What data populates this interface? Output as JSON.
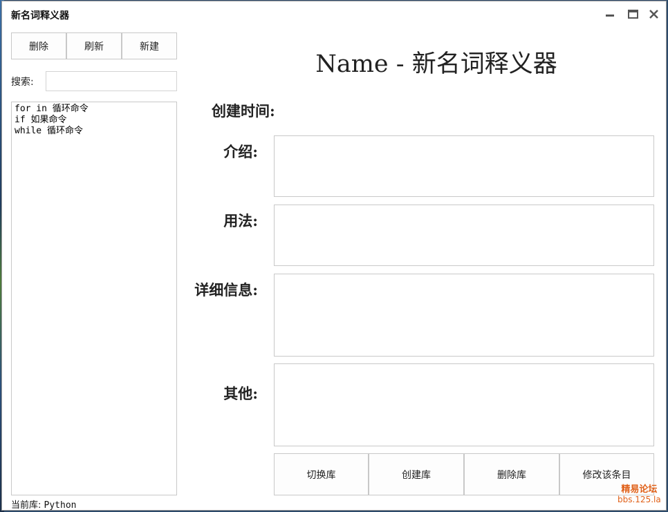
{
  "window": {
    "title": "新名词释义器",
    "controls": {
      "minimize": "minimize-icon",
      "maximize": "maximize-icon",
      "close": "close-icon"
    }
  },
  "toolbar": {
    "delete_label": "删除",
    "refresh_label": "刷新",
    "new_label": "新建"
  },
  "search": {
    "label": "搜索:",
    "value": ""
  },
  "list": {
    "items": [
      "for in 循环命令",
      "if 如果命令",
      "while 循环命令"
    ]
  },
  "status": {
    "label": "当前库:",
    "value": "Python"
  },
  "detail": {
    "heading": "Name - 新名词释义器",
    "created_label": "创建时间:",
    "created_value": "",
    "intro_label": "介绍:",
    "usage_label": "用法:",
    "details_label": "详细信息:",
    "other_label": "其他:",
    "intro_value": "",
    "usage_value": "",
    "details_value": "",
    "other_value": ""
  },
  "actions": {
    "switch_label": "切换库",
    "create_label": "创建库",
    "delete_label": "删除库",
    "modify_label": "修改该条目"
  },
  "watermark": {
    "line1": "精易论坛",
    "line2": "bbs.125.la"
  },
  "colors": {
    "accent": "#e06018",
    "window_bg": "#ffffff",
    "border": "#c8c8c8"
  }
}
